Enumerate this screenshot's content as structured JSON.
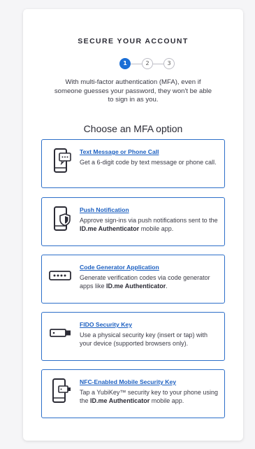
{
  "header": {
    "title": "SECURE YOUR ACCOUNT",
    "steps": [
      "1",
      "2",
      "3"
    ]
  },
  "intro": {
    "text": "With multi-factor authentication (MFA), even if someone guesses your password, they won't be able to sign in as you."
  },
  "options_heading": "Choose an MFA option",
  "options": [
    {
      "title": "Text Message or Phone Call",
      "desc_before": "Get a 6-digit code by text message or phone call.",
      "desc_bold": "",
      "desc_after": "",
      "icon": "phone-message-icon"
    },
    {
      "title": "Push Notification",
      "desc_before": "Approve sign-ins via push notifications sent to the ",
      "desc_bold": "ID.me Authenticator",
      "desc_after": " mobile app.",
      "icon": "phone-shield-icon"
    },
    {
      "title": "Code Generator Application",
      "desc_before": "Generate verification codes via code generator apps like ",
      "desc_bold": "ID.me Authenticator",
      "desc_after": ".",
      "icon": "code-field-icon"
    },
    {
      "title": "FIDO Security Key",
      "desc_before": "Use a physical security key (insert or tap) with your device (supported browsers only).",
      "desc_bold": "",
      "desc_after": "",
      "icon": "usb-key-icon"
    },
    {
      "title": "NFC-Enabled Mobile Security Key",
      "desc_before": "Tap a YubiKey™ security key to your phone using the ",
      "desc_bold": "ID.me Authenticator",
      "desc_after": " mobile app.",
      "icon": "phone-nfc-key-icon"
    }
  ],
  "colors": {
    "accent": "#1b6fd6",
    "link": "#1b5fc1",
    "border": "#2d6fc9",
    "text": "#2b2b35"
  }
}
